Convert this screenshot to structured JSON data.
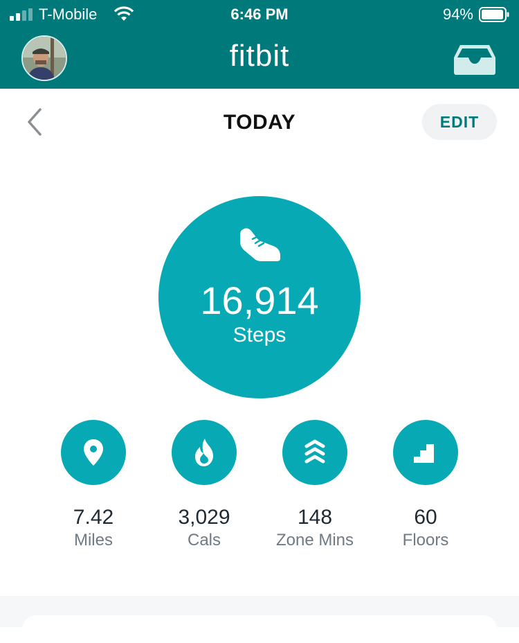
{
  "status_bar": {
    "carrier": "T-Mobile",
    "time": "6:46 PM",
    "battery": "94%"
  },
  "header": {
    "title": "fitbit",
    "avatar_icon": "user-avatar",
    "inbox_icon": "inbox-icon"
  },
  "day_nav": {
    "title": "TODAY",
    "edit_label": "EDIT"
  },
  "steps": {
    "value": "16,914",
    "label": "Steps",
    "icon": "shoe-icon"
  },
  "stats": [
    {
      "value": "7.42",
      "label": "Miles",
      "icon": "location-pin-icon"
    },
    {
      "value": "3,029",
      "label": "Cals",
      "icon": "flame-icon"
    },
    {
      "value": "148",
      "label": "Zone Mins",
      "icon": "chevrons-up-icon"
    },
    {
      "value": "60",
      "label": "Floors",
      "icon": "stairs-icon"
    }
  ],
  "colors": {
    "header": "#00797b",
    "accent": "#07aab4",
    "edit_text": "#007a7c"
  }
}
